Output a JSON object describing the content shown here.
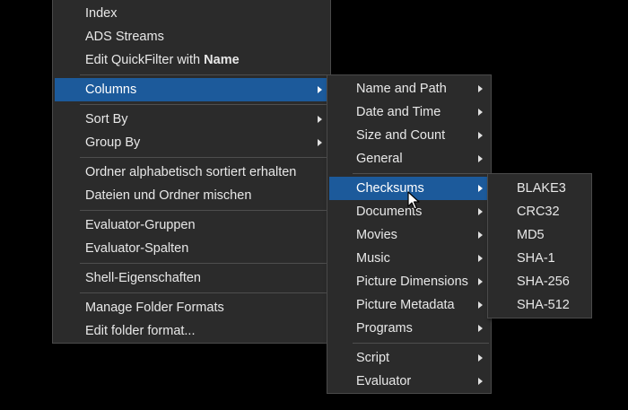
{
  "menu_main": {
    "items": {
      "index": "Index",
      "ads_streams": "ADS Streams",
      "edit_quickfilter_prefix": "Edit QuickFilter with ",
      "edit_quickfilter_bold": "Name",
      "columns": "Columns",
      "sort_by": "Sort By",
      "group_by": "Group By",
      "keep_folders_sorted": "Ordner alphabetisch sortiert erhalten",
      "mix_files_folders": "Dateien und Ordner mischen",
      "evaluator_groups": "Evaluator-Gruppen",
      "evaluator_columns": "Evaluator-Spalten",
      "shell_properties": "Shell-Eigenschaften",
      "manage_folder_formats": "Manage Folder Formats",
      "edit_folder_format": "Edit folder format..."
    }
  },
  "menu_columns": {
    "items": {
      "name_and_path": "Name and Path",
      "date_and_time": "Date and Time",
      "size_and_count": "Size and Count",
      "general": "General",
      "checksums": "Checksums",
      "documents": "Documents",
      "movies": "Movies",
      "music": "Music",
      "picture_dimensions": "Picture Dimensions",
      "picture_metadata": "Picture Metadata",
      "programs": "Programs",
      "script": "Script",
      "evaluator": "Evaluator"
    }
  },
  "menu_checksums": {
    "items": {
      "blake3": "BLAKE3",
      "crc32": "CRC32",
      "md5": "MD5",
      "sha1": "SHA-1",
      "sha256": "SHA-256",
      "sha512": "SHA-512"
    }
  },
  "colors": {
    "menu_bg": "#2b2b2b",
    "highlight": "#1c5a9b",
    "text": "#e8e8e8",
    "separator": "#4e4e4e",
    "page_bg": "#000000"
  }
}
